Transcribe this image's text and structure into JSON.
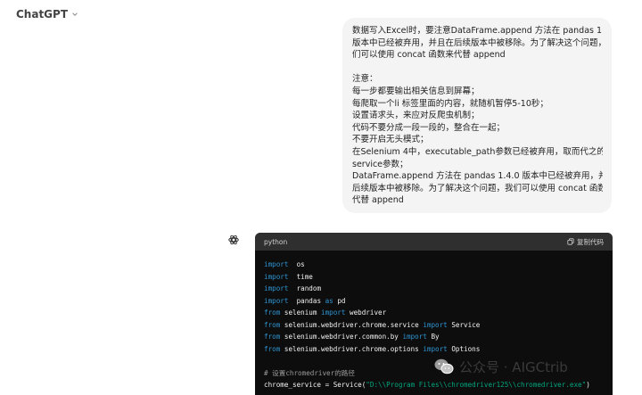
{
  "header": {
    "model_name": "ChatGPT"
  },
  "user_message": {
    "lines": [
      "数据写入Excel时，要注意DataFrame.append 方法在 pandas 1.4.0",
      "版本中已经被弃用，并且在后续版本中被移除。为了解决这个问题，我",
      "们可以使用 concat 函数来代替 append",
      "",
      "注意：",
      "每一步都要输出相关信息到屏幕；",
      "每爬取一个li 标签里面的内容，就随机暂停5-10秒；",
      "设置请求头，来应对反爬虫机制；",
      "代码不要分成一段一段的，整合在一起；",
      "不要开启无头模式；",
      "在Selenium 4中，executable_path参数已经被弃用，取而代之的是",
      "service参数；",
      "DataFrame.append 方法在 pandas 1.4.0 版本中已经被弃用，并且在",
      "后续版本中被移除。为了解决这个问题，我们可以使用 concat 函数来",
      "代替 append"
    ]
  },
  "code_block": {
    "language": "python",
    "copy_label": "复制代码",
    "lines": [
      [
        [
          "kw",
          "import"
        ],
        [
          "",
          "  os"
        ]
      ],
      [
        [
          "kw",
          "import"
        ],
        [
          "",
          "  time"
        ]
      ],
      [
        [
          "kw",
          "import"
        ],
        [
          "",
          "  random"
        ]
      ],
      [
        [
          "kw",
          "import"
        ],
        [
          "",
          "  pandas "
        ],
        [
          "kw",
          "as"
        ],
        [
          "",
          " pd"
        ]
      ],
      [
        [
          "kw",
          "from"
        ],
        [
          "",
          " selenium "
        ],
        [
          "kw",
          "import"
        ],
        [
          "",
          " webdriver"
        ]
      ],
      [
        [
          "kw",
          "from"
        ],
        [
          "",
          " selenium.webdriver.chrome.service "
        ],
        [
          "kw",
          "import"
        ],
        [
          "",
          " Service"
        ]
      ],
      [
        [
          "kw",
          "from"
        ],
        [
          "",
          " selenium.webdriver.common.by "
        ],
        [
          "kw",
          "import"
        ],
        [
          "",
          " By"
        ]
      ],
      [
        [
          "kw",
          "from"
        ],
        [
          "",
          " selenium.webdriver.chrome.options "
        ],
        [
          "kw",
          "import"
        ],
        [
          "",
          " Options"
        ]
      ],
      [],
      [
        [
          "cm",
          "# 设置chromedriver的路径"
        ]
      ],
      [
        [
          "",
          "chrome_service = Service("
        ],
        [
          "st",
          "\"D:\\\\Program Files\\\\chromedriver125\\\\chromedriver.exe\""
        ],
        [
          "",
          ")"
        ]
      ]
    ]
  },
  "watermark": {
    "text": "公众号 · AIGCtrib"
  },
  "colors": {
    "keyword": "#2e95d3",
    "comment": "#9a9a9a",
    "string": "#00a67d",
    "code_bg": "#0d0d0d",
    "code_header_bg": "#2f2f2f",
    "bubble_bg": "#f4f4f4"
  },
  "icons": {
    "model_chevron": "chevron-down-icon",
    "assistant": "openai-logo-icon",
    "copy": "copy-icon",
    "watermark": "wechat-logo-icon"
  }
}
